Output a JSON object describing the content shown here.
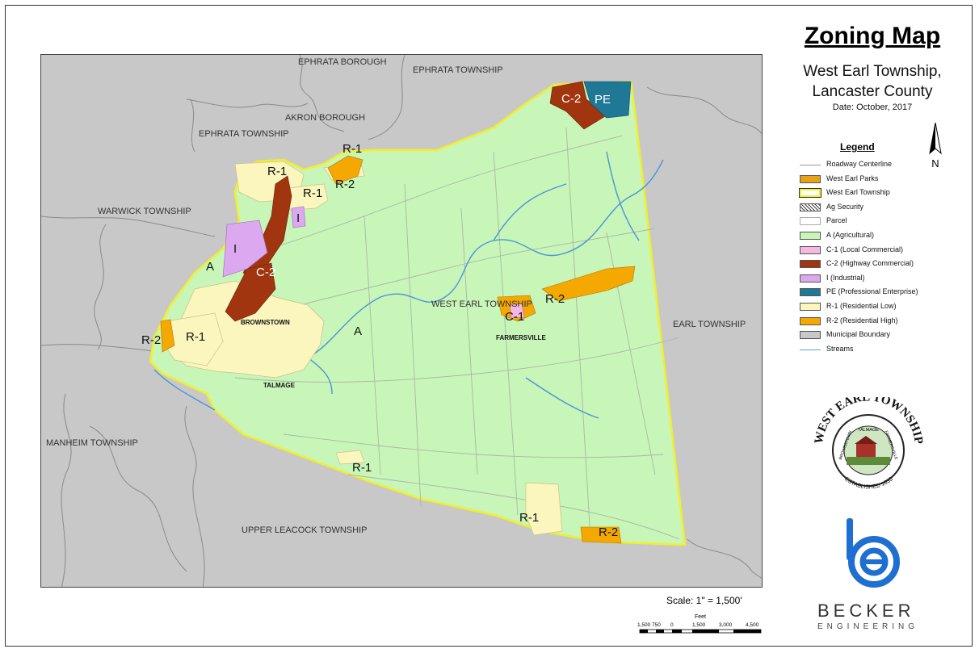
{
  "title": "Zoning Map",
  "subtitle_line1": "West Earl Township,",
  "subtitle_line2": "Lancaster County",
  "date": "Date: October, 2017",
  "north_label": "N",
  "legend": {
    "title": "Legend",
    "items": [
      {
        "label": "Roadway Centerline",
        "type": "line",
        "color": "#aaaaaa"
      },
      {
        "label": "West Earl Parks",
        "type": "fill",
        "color": "#e8a21a"
      },
      {
        "label": "West Earl Township",
        "type": "outline",
        "color": "#f2ef2a"
      },
      {
        "label": "Ag Security",
        "type": "hatch",
        "color": "#555555"
      },
      {
        "label": "Parcel",
        "type": "fill",
        "color": "#ffffff"
      },
      {
        "label": "A (Agricultural)",
        "type": "fill",
        "color": "#c8f5b8"
      },
      {
        "label": "C-1 (Local Commercial)",
        "type": "fill",
        "color": "#f5b8e0"
      },
      {
        "label": "C-2 (Highway Commercial)",
        "type": "fill",
        "color": "#a0350f"
      },
      {
        "label": "I (Industrial)",
        "type": "fill",
        "color": "#dca8f0"
      },
      {
        "label": "PE (Professional Enterprise)",
        "type": "fill",
        "color": "#1e7896"
      },
      {
        "label": "R-1 (Residential Low)",
        "type": "fill",
        "color": "#fbf5be"
      },
      {
        "label": "R-2 (Residential High)",
        "type": "fill",
        "color": "#f5a800"
      },
      {
        "label": "Municipal Boundary",
        "type": "fill",
        "color": "#c8c8c8"
      },
      {
        "label": "Streams",
        "type": "stream",
        "color": "#5aa0d8"
      }
    ]
  },
  "map": {
    "neighbors": {
      "ephrata_borough": "EPHRATA BOROUGH",
      "ephrata_township_top": "EPHRATA TOWNSHIP",
      "akron_borough": "AKRON BOROUGH",
      "ephrata_township_left": "EPHRATA TOWNSHIP",
      "warwick_township": "WARWICK TOWNSHIP",
      "earl_township": "EARL TOWNSHIP",
      "manheim_township": "MANHEIM TOWNSHIP",
      "upper_leacock_township": "UPPER LEACOCK TOWNSHIP"
    },
    "township_label": "WEST EARL TOWNSHIP",
    "towns": {
      "brownstown": "BROWNSTOWN",
      "farmersville": "FARMERSVILLE",
      "talmage": "TALMAGE"
    },
    "zones": {
      "a1": "A",
      "a2": "A",
      "r1_top": "R-1",
      "r1_a": "R-1",
      "r1_b": "R-1",
      "r1_left": "R-1",
      "r1_south": "R-1",
      "r1_se": "R-1",
      "r2_top": "R-2",
      "r2_left": "R-2",
      "r2_east": "R-2",
      "r2_se": "R-2",
      "c2_top": "C-2",
      "c2_mid": "C-2",
      "pe": "PE",
      "c1": "C-1",
      "i1": "I",
      "i2": "I"
    }
  },
  "scale": {
    "text": "Scale: 1\" = 1,500'",
    "unit": "Feet",
    "ticks": [
      "1,500",
      "750",
      "0",
      "1,500",
      "3,000",
      "4,500"
    ]
  },
  "seal": {
    "top_text": "WEST EARL TOWNSHIP",
    "ring_left": "BROWNSTOWN",
    "ring_top": "TALMAGE",
    "ring_right": "FARMERSVILLE",
    "bottom_text": "ESTABLISHED 1833"
  },
  "becker": {
    "line1": "BECKER",
    "line2": "ENGINEERING",
    "color": "#1e6fd0"
  }
}
